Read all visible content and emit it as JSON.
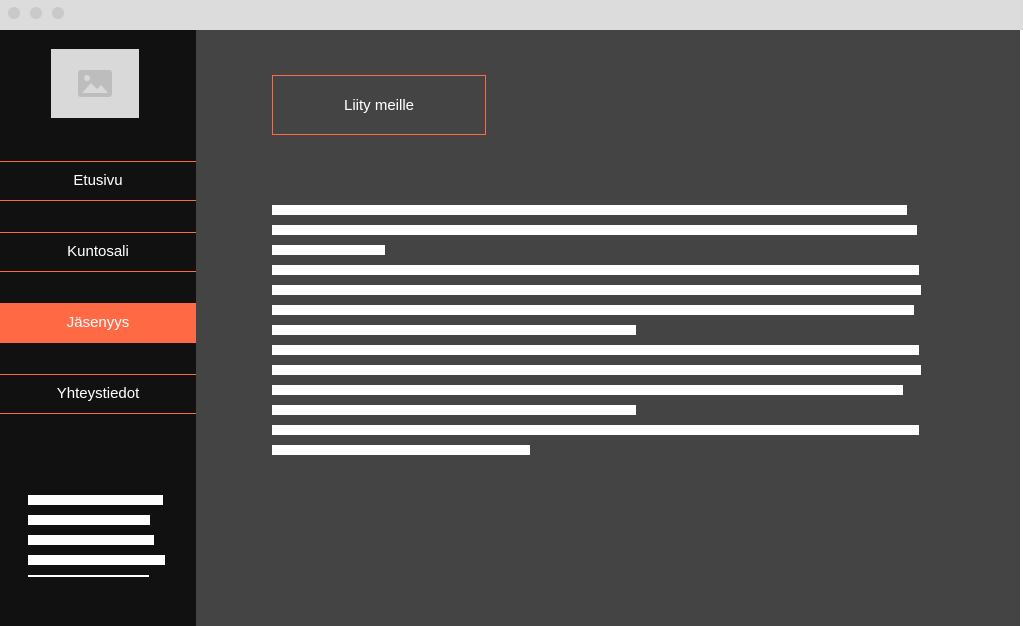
{
  "window": {
    "controls": [
      "close",
      "minimize",
      "maximize"
    ]
  },
  "sidebar": {
    "logo_icon": "image-placeholder-icon",
    "items": [
      {
        "label": "Etusivu",
        "active": false
      },
      {
        "label": "Kuntosali",
        "active": false
      },
      {
        "label": "Jäsenyys",
        "active": true
      },
      {
        "label": "Yhteystiedot",
        "active": false
      }
    ]
  },
  "main": {
    "cta_label": "Liity meille"
  },
  "colors": {
    "accent": "#ff6a45",
    "sidebar_bg": "#111111",
    "main_bg": "#444444",
    "text": "#ffffff"
  }
}
